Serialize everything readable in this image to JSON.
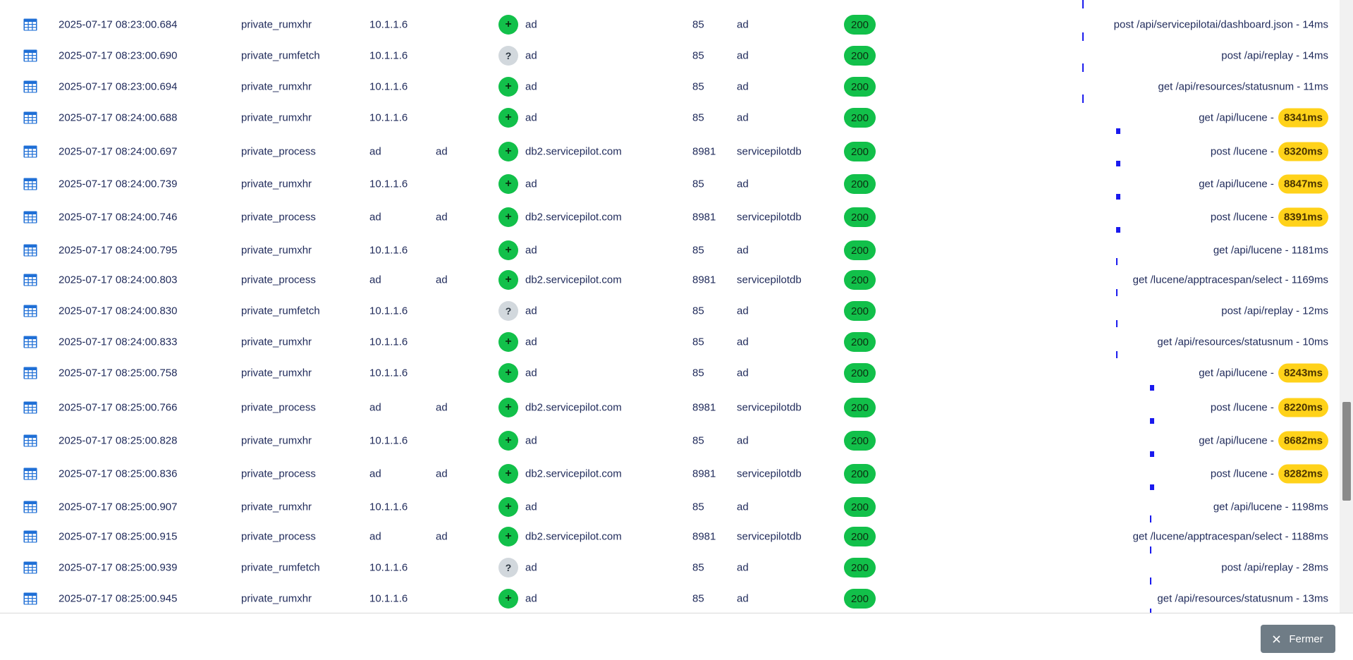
{
  "rows": [
    {
      "time": "2025-07-17 08:23:00.684",
      "type": "private_rumxhr",
      "ip": "10.1.1.6",
      "extra": "",
      "badge": "+",
      "badge_kind": "ok",
      "host": "ad",
      "port": "85",
      "db": "ad",
      "status": "200",
      "req": "post /api/servicepilotai/dashboard.json - 14ms",
      "dur": ""
    },
    {
      "time": "2025-07-17 08:23:00.690",
      "type": "private_rumfetch",
      "ip": "10.1.1.6",
      "extra": "",
      "badge": "?",
      "badge_kind": "unknown",
      "host": "ad",
      "port": "85",
      "db": "ad",
      "status": "200",
      "req": "post /api/replay - 14ms",
      "dur": ""
    },
    {
      "time": "2025-07-17 08:23:00.694",
      "type": "private_rumxhr",
      "ip": "10.1.1.6",
      "extra": "",
      "badge": "+",
      "badge_kind": "ok",
      "host": "ad",
      "port": "85",
      "db": "ad",
      "status": "200",
      "req": "get /api/resources/statusnum - 11ms",
      "dur": ""
    },
    {
      "time": "2025-07-17 08:24:00.688",
      "type": "private_rumxhr",
      "ip": "10.1.1.6",
      "extra": "",
      "badge": "+",
      "badge_kind": "ok",
      "host": "ad",
      "port": "85",
      "db": "ad",
      "status": "200",
      "req": "get /api/lucene -",
      "dur": "8341ms"
    },
    {
      "time": "2025-07-17 08:24:00.697",
      "type": "private_process",
      "ip": "ad",
      "extra": "ad",
      "badge": "+",
      "badge_kind": "ok",
      "host": "db2.servicepilot.com",
      "port": "8981",
      "db": "servicepilotdb",
      "status": "200",
      "req": "post /lucene -",
      "dur": "8320ms"
    },
    {
      "time": "2025-07-17 08:24:00.739",
      "type": "private_rumxhr",
      "ip": "10.1.1.6",
      "extra": "",
      "badge": "+",
      "badge_kind": "ok",
      "host": "ad",
      "port": "85",
      "db": "ad",
      "status": "200",
      "req": "get /api/lucene -",
      "dur": "8847ms"
    },
    {
      "time": "2025-07-17 08:24:00.746",
      "type": "private_process",
      "ip": "ad",
      "extra": "ad",
      "badge": "+",
      "badge_kind": "ok",
      "host": "db2.servicepilot.com",
      "port": "8981",
      "db": "servicepilotdb",
      "status": "200",
      "req": "post /lucene -",
      "dur": "8391ms"
    },
    {
      "time": "2025-07-17 08:24:00.795",
      "type": "private_rumxhr",
      "ip": "10.1.1.6",
      "extra": "",
      "badge": "+",
      "badge_kind": "ok",
      "host": "ad",
      "port": "85",
      "db": "ad",
      "status": "200",
      "req": "get /api/lucene - 1181ms",
      "dur": ""
    },
    {
      "time": "2025-07-17 08:24:00.803",
      "type": "private_process",
      "ip": "ad",
      "extra": "ad",
      "badge": "+",
      "badge_kind": "ok",
      "host": "db2.servicepilot.com",
      "port": "8981",
      "db": "servicepilotdb",
      "status": "200",
      "req": "get /lucene/apptracespan/select - 1169ms",
      "dur": ""
    },
    {
      "time": "2025-07-17 08:24:00.830",
      "type": "private_rumfetch",
      "ip": "10.1.1.6",
      "extra": "",
      "badge": "?",
      "badge_kind": "unknown",
      "host": "ad",
      "port": "85",
      "db": "ad",
      "status": "200",
      "req": "post /api/replay - 12ms",
      "dur": ""
    },
    {
      "time": "2025-07-17 08:24:00.833",
      "type": "private_rumxhr",
      "ip": "10.1.1.6",
      "extra": "",
      "badge": "+",
      "badge_kind": "ok",
      "host": "ad",
      "port": "85",
      "db": "ad",
      "status": "200",
      "req": "get /api/resources/statusnum - 10ms",
      "dur": ""
    },
    {
      "time": "2025-07-17 08:25:00.758",
      "type": "private_rumxhr",
      "ip": "10.1.1.6",
      "extra": "",
      "badge": "+",
      "badge_kind": "ok",
      "host": "ad",
      "port": "85",
      "db": "ad",
      "status": "200",
      "req": "get /api/lucene -",
      "dur": "8243ms"
    },
    {
      "time": "2025-07-17 08:25:00.766",
      "type": "private_process",
      "ip": "ad",
      "extra": "ad",
      "badge": "+",
      "badge_kind": "ok",
      "host": "db2.servicepilot.com",
      "port": "8981",
      "db": "servicepilotdb",
      "status": "200",
      "req": "post /lucene -",
      "dur": "8220ms"
    },
    {
      "time": "2025-07-17 08:25:00.828",
      "type": "private_rumxhr",
      "ip": "10.1.1.6",
      "extra": "",
      "badge": "+",
      "badge_kind": "ok",
      "host": "ad",
      "port": "85",
      "db": "ad",
      "status": "200",
      "req": "get /api/lucene -",
      "dur": "8682ms"
    },
    {
      "time": "2025-07-17 08:25:00.836",
      "type": "private_process",
      "ip": "ad",
      "extra": "ad",
      "badge": "+",
      "badge_kind": "ok",
      "host": "db2.servicepilot.com",
      "port": "8981",
      "db": "servicepilotdb",
      "status": "200",
      "req": "post /lucene -",
      "dur": "8282ms"
    },
    {
      "time": "2025-07-17 08:25:00.907",
      "type": "private_rumxhr",
      "ip": "10.1.1.6",
      "extra": "",
      "badge": "+",
      "badge_kind": "ok",
      "host": "ad",
      "port": "85",
      "db": "ad",
      "status": "200",
      "req": "get /api/lucene - 1198ms",
      "dur": ""
    },
    {
      "time": "2025-07-17 08:25:00.915",
      "type": "private_process",
      "ip": "ad",
      "extra": "ad",
      "badge": "+",
      "badge_kind": "ok",
      "host": "db2.servicepilot.com",
      "port": "8981",
      "db": "servicepilotdb",
      "status": "200",
      "req": "get /lucene/apptracespan/select - 1188ms",
      "dur": ""
    },
    {
      "time": "2025-07-17 08:25:00.939",
      "type": "private_rumfetch",
      "ip": "10.1.1.6",
      "extra": "",
      "badge": "?",
      "badge_kind": "unknown",
      "host": "ad",
      "port": "85",
      "db": "ad",
      "status": "200",
      "req": "post /api/replay - 28ms",
      "dur": ""
    },
    {
      "time": "2025-07-17 08:25:00.945",
      "type": "private_rumxhr",
      "ip": "10.1.1.6",
      "extra": "",
      "badge": "+",
      "badge_kind": "ok",
      "host": "ad",
      "port": "85",
      "db": "ad",
      "status": "200",
      "req": "get /api/resources/statusnum - 13ms",
      "dur": ""
    }
  ],
  "colors": {
    "accent": "#12c04a",
    "warn": "#ffd21a",
    "bar": "#1a1aee",
    "close_button": "#6f7c86"
  },
  "icons": {
    "row": "table-icon",
    "close": "close-icon"
  },
  "footer": {
    "close_label": "Fermer"
  }
}
